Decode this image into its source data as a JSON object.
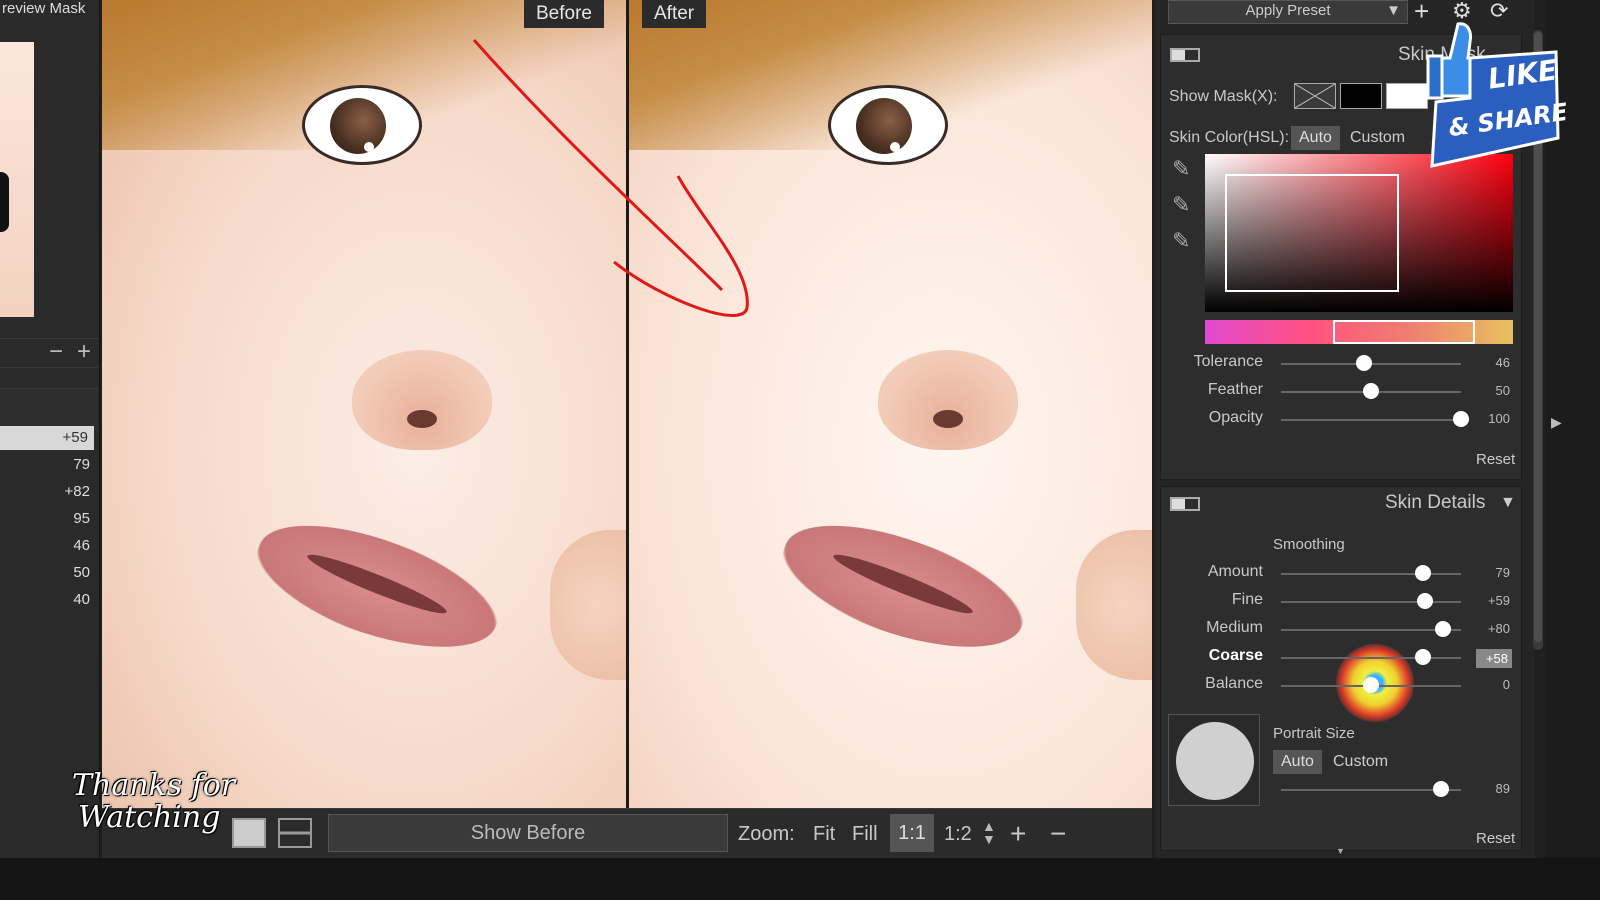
{
  "left_panel": {
    "title": "review Mask",
    "zoom_minus": "−",
    "zoom_plus": "+",
    "values": [
      "+59",
      "79",
      "+82",
      "95",
      "46",
      "50",
      "40"
    ]
  },
  "photo": {
    "before_label": "Before",
    "after_label": "After"
  },
  "toolbar": {
    "show_before": "Show Before",
    "zoom_label": "Zoom:",
    "fit": "Fit",
    "fill": "Fill",
    "zoom_1_1": "1:1",
    "zoom_1_2": "1:2",
    "zoom_in": "+",
    "zoom_out": "−"
  },
  "overlay": {
    "thanks_line1": "Thanks for",
    "thanks_line2": "Watching",
    "like_line1": "LIKE",
    "like_line2": "& SHARE"
  },
  "right_panel": {
    "preset": {
      "label": "Apply Preset",
      "add": "+"
    },
    "skin_mask": {
      "header": "Skin Mask",
      "show_mask_label": "Show Mask(X):",
      "skin_color_label": "Skin Color(HSL):",
      "auto": "Auto",
      "custom": "Custom",
      "sliders": [
        {
          "label": "Tolerance",
          "value": "46",
          "pos": 0.46
        },
        {
          "label": "Feather",
          "value": "50",
          "pos": 0.5
        },
        {
          "label": "Opacity",
          "value": "100",
          "pos": 1.0
        }
      ],
      "reset": "Reset"
    },
    "skin_details": {
      "header": "Skin Details",
      "smoothing_label": "Smoothing",
      "sliders": [
        {
          "label": "Amount",
          "value": "79",
          "pos": 0.79
        },
        {
          "label": "Fine",
          "value": "+59",
          "pos": 0.8
        },
        {
          "label": "Medium",
          "value": "+80",
          "pos": 0.9
        },
        {
          "label": "Coarse",
          "value": "+58",
          "pos": 0.79
        },
        {
          "label": "Balance",
          "value": "0",
          "pos": 0.5
        }
      ],
      "portrait_size_label": "Portrait Size",
      "auto": "Auto",
      "custom": "Custom",
      "portrait_value": "89",
      "portrait_pos": 0.89,
      "reset": "Reset"
    }
  }
}
